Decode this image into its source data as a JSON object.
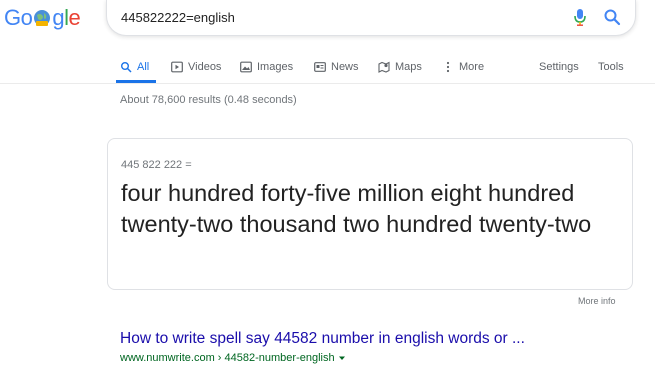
{
  "logo": {
    "prefix": "Go",
    "suffix_g": "g",
    "suffix_l": "l",
    "suffix_e": "e"
  },
  "search": {
    "value": "445822222=english",
    "placeholder": ""
  },
  "tabs": [
    {
      "label": "All",
      "icon": "search-icon",
      "active": true
    },
    {
      "label": "Videos",
      "icon": "video-icon"
    },
    {
      "label": "Images",
      "icon": "image-icon"
    },
    {
      "label": "News",
      "icon": "news-icon"
    },
    {
      "label": "Maps",
      "icon": "maps-icon"
    },
    {
      "label": "More",
      "icon": "more-vert-icon"
    },
    {
      "label": "Settings"
    },
    {
      "label": "Tools"
    }
  ],
  "result_stats": "About 78,600 results (0.48 seconds)",
  "answer_card": {
    "query": "445 822 222 =",
    "answer": "four hundred forty-five million eight hundred twenty-two thousand two hundred twenty-two",
    "more_info": "More info"
  },
  "results": [
    {
      "title": "How to write spell say 44582 number in english words or ...",
      "url": "www.numwrite.com › 44582-number-english"
    }
  ],
  "colors": {
    "accent": "#1a73e8",
    "link": "#1a0dab",
    "url_green": "#006621",
    "muted": "#70757a"
  }
}
